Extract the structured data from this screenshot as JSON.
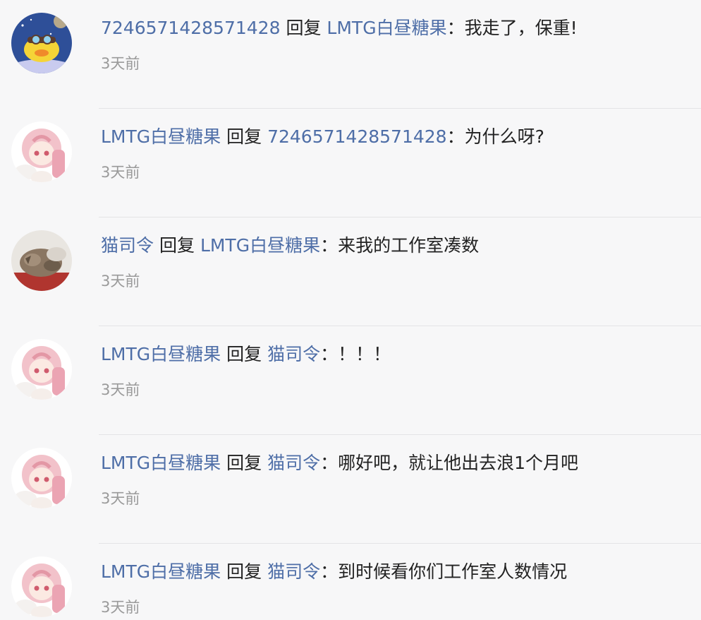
{
  "comments": [
    {
      "user": "7246571428571428",
      "reply_word": "回复",
      "target": "LMTG白昼糖果",
      "colon": "：",
      "text": "我走了，保重!",
      "time": "3天前",
      "avatar": "duck-space-avatar"
    },
    {
      "user": "LMTG白昼糖果",
      "reply_word": "回复",
      "target": "7246571428571428",
      "colon": "：",
      "text": "为什么呀?",
      "time": "3天前",
      "avatar": "anime-girl-avatar"
    },
    {
      "user": "猫司令",
      "reply_word": "回复",
      "target": "LMTG白昼糖果",
      "colon": "：",
      "text": "来我的工作室凑数",
      "time": "3天前",
      "avatar": "cat-avatar"
    },
    {
      "user": "LMTG白昼糖果",
      "reply_word": "回复",
      "target": "猫司令",
      "colon": "：",
      "text": "！！！",
      "time": "3天前",
      "avatar": "anime-girl-avatar"
    },
    {
      "user": "LMTG白昼糖果",
      "reply_word": "回复",
      "target": "猫司令",
      "colon": "：",
      "text": "哪好吧，就让他出去浪1个月吧",
      "time": "3天前",
      "avatar": "anime-girl-avatar"
    },
    {
      "user": "LMTG白昼糖果",
      "reply_word": "回复",
      "target": "猫司令",
      "colon": "：",
      "text": "到时候看你们工作室人数情况",
      "time": "3天前",
      "avatar": "anime-girl-avatar"
    }
  ],
  "colors": {
    "username": "#4e6ea7",
    "text": "#222222",
    "time": "#9a9a9a",
    "background": "#f7f7f8",
    "divider": "#e4e4e6"
  }
}
